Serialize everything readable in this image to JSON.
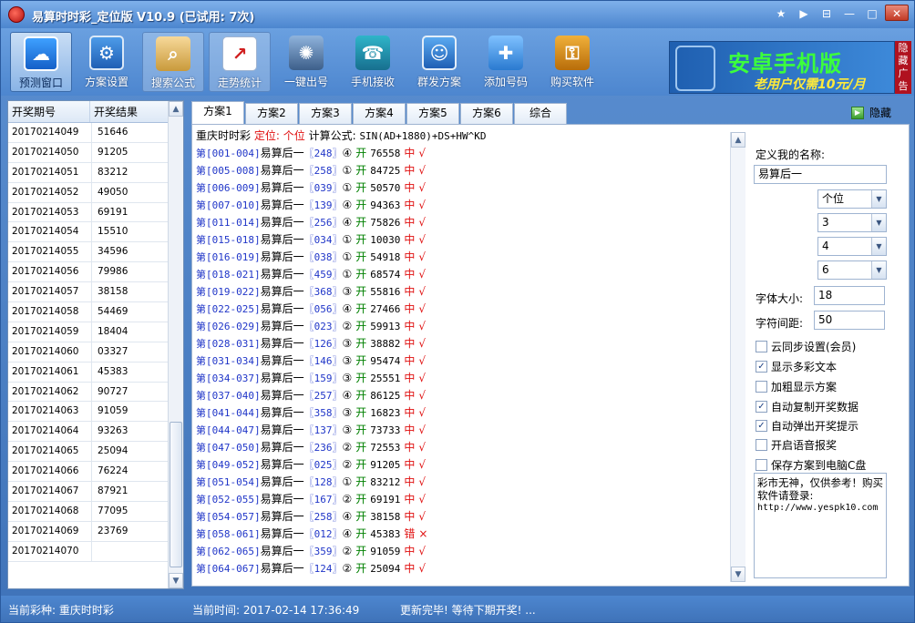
{
  "window": {
    "title": "易算时时彩_定位版 V10.9 (已试用: 7次)",
    "controls": [
      "★",
      "▶",
      "⊟",
      "—",
      "□",
      "✕"
    ]
  },
  "toolbar": {
    "items": [
      {
        "label": "预测窗口",
        "icon": "cloud-icon"
      },
      {
        "label": "方案设置",
        "icon": "settings-icon"
      },
      {
        "label": "搜索公式",
        "icon": "search-formula-icon"
      },
      {
        "label": "走势统计",
        "icon": "trend-chart-icon"
      },
      {
        "label": "一键出号",
        "icon": "gear-icon"
      },
      {
        "label": "手机接收",
        "icon": "phone-icon"
      },
      {
        "label": "群发方案",
        "icon": "group-icon"
      },
      {
        "label": "添加号码",
        "icon": "add-folder-icon"
      },
      {
        "label": "购买软件",
        "icon": "key-icon"
      }
    ]
  },
  "ad": {
    "title": "安卓手机版",
    "subtitle": "老用户仅需10元/月",
    "side_label": "隐藏广告"
  },
  "draw_list": {
    "headers": [
      "开奖期号",
      "开奖结果"
    ],
    "rows": [
      [
        "20170214049",
        "51646"
      ],
      [
        "20170214050",
        "91205"
      ],
      [
        "20170214051",
        "83212"
      ],
      [
        "20170214052",
        "49050"
      ],
      [
        "20170214053",
        "69191"
      ],
      [
        "20170214054",
        "15510"
      ],
      [
        "20170214055",
        "34596"
      ],
      [
        "20170214056",
        "79986"
      ],
      [
        "20170214057",
        "38158"
      ],
      [
        "20170214058",
        "54469"
      ],
      [
        "20170214059",
        "18404"
      ],
      [
        "20170214060",
        "03327"
      ],
      [
        "20170214061",
        "45383"
      ],
      [
        "20170214062",
        "90727"
      ],
      [
        "20170214063",
        "91059"
      ],
      [
        "20170214064",
        "93263"
      ],
      [
        "20170214065",
        "25094"
      ],
      [
        "20170214066",
        "76224"
      ],
      [
        "20170214067",
        "87921"
      ],
      [
        "20170214068",
        "77095"
      ],
      [
        "20170214069",
        "23769"
      ],
      [
        "20170214070",
        ""
      ]
    ]
  },
  "tabs": [
    "方案1",
    "方案2",
    "方案3",
    "方案4",
    "方案5",
    "方案6",
    "综合"
  ],
  "hide_label": "隐藏",
  "plan": {
    "header_game": "重庆时时彩",
    "header_pos_label": "定位:",
    "header_pos_value": "个位",
    "header_formula_label": "计算公式:",
    "header_formula": "SIN(AD+1880)+DS+HW^KD",
    "lines": [
      {
        "range": "第[001-004]",
        "name": "易算后一",
        "code": "〖248〗",
        "circle": "④",
        "open": "开",
        "result": "76558",
        "status": "中",
        "mark": "√"
      },
      {
        "range": "第[005-008]",
        "name": "易算后一",
        "code": "〖258〗",
        "circle": "①",
        "open": "开",
        "result": "84725",
        "status": "中",
        "mark": "√"
      },
      {
        "range": "第[006-009]",
        "name": "易算后一",
        "code": "〖039〗",
        "circle": "①",
        "open": "开",
        "result": "50570",
        "status": "中",
        "mark": "√"
      },
      {
        "range": "第[007-010]",
        "name": "易算后一",
        "code": "〖139〗",
        "circle": "④",
        "open": "开",
        "result": "94363",
        "status": "中",
        "mark": "√"
      },
      {
        "range": "第[011-014]",
        "name": "易算后一",
        "code": "〖256〗",
        "circle": "④",
        "open": "开",
        "result": "75826",
        "status": "中",
        "mark": "√"
      },
      {
        "range": "第[015-018]",
        "name": "易算后一",
        "code": "〖034〗",
        "circle": "①",
        "open": "开",
        "result": "10030",
        "status": "中",
        "mark": "√"
      },
      {
        "range": "第[016-019]",
        "name": "易算后一",
        "code": "〖038〗",
        "circle": "①",
        "open": "开",
        "result": "54918",
        "status": "中",
        "mark": "√"
      },
      {
        "range": "第[018-021]",
        "name": "易算后一",
        "code": "〖459〗",
        "circle": "①",
        "open": "开",
        "result": "68574",
        "status": "中",
        "mark": "√"
      },
      {
        "range": "第[019-022]",
        "name": "易算后一",
        "code": "〖368〗",
        "circle": "③",
        "open": "开",
        "result": "55816",
        "status": "中",
        "mark": "√"
      },
      {
        "range": "第[022-025]",
        "name": "易算后一",
        "code": "〖056〗",
        "circle": "④",
        "open": "开",
        "result": "27466",
        "status": "中",
        "mark": "√"
      },
      {
        "range": "第[026-029]",
        "name": "易算后一",
        "code": "〖023〗",
        "circle": "②",
        "open": "开",
        "result": "59913",
        "status": "中",
        "mark": "√"
      },
      {
        "range": "第[028-031]",
        "name": "易算后一",
        "code": "〖126〗",
        "circle": "③",
        "open": "开",
        "result": "38882",
        "status": "中",
        "mark": "√"
      },
      {
        "range": "第[031-034]",
        "name": "易算后一",
        "code": "〖146〗",
        "circle": "③",
        "open": "开",
        "result": "95474",
        "status": "中",
        "mark": "√"
      },
      {
        "range": "第[034-037]",
        "name": "易算后一",
        "code": "〖159〗",
        "circle": "③",
        "open": "开",
        "result": "25551",
        "status": "中",
        "mark": "√"
      },
      {
        "range": "第[037-040]",
        "name": "易算后一",
        "code": "〖257〗",
        "circle": "④",
        "open": "开",
        "result": "86125",
        "status": "中",
        "mark": "√"
      },
      {
        "range": "第[041-044]",
        "name": "易算后一",
        "code": "〖358〗",
        "circle": "③",
        "open": "开",
        "result": "16823",
        "status": "中",
        "mark": "√"
      },
      {
        "range": "第[044-047]",
        "name": "易算后一",
        "code": "〖137〗",
        "circle": "③",
        "open": "开",
        "result": "73733",
        "status": "中",
        "mark": "√"
      },
      {
        "range": "第[047-050]",
        "name": "易算后一",
        "code": "〖236〗",
        "circle": "②",
        "open": "开",
        "result": "72553",
        "status": "中",
        "mark": "√"
      },
      {
        "range": "第[049-052]",
        "name": "易算后一",
        "code": "〖025〗",
        "circle": "②",
        "open": "开",
        "result": "91205",
        "status": "中",
        "mark": "√"
      },
      {
        "range": "第[051-054]",
        "name": "易算后一",
        "code": "〖128〗",
        "circle": "①",
        "open": "开",
        "result": "83212",
        "status": "中",
        "mark": "√"
      },
      {
        "range": "第[052-055]",
        "name": "易算后一",
        "code": "〖167〗",
        "circle": "②",
        "open": "开",
        "result": "69191",
        "status": "中",
        "mark": "√"
      },
      {
        "range": "第[054-057]",
        "name": "易算后一",
        "code": "〖258〗",
        "circle": "④",
        "open": "开",
        "result": "38158",
        "status": "中",
        "mark": "√"
      },
      {
        "range": "第[058-061]",
        "name": "易算后一",
        "code": "〖012〗",
        "circle": "④",
        "open": "开",
        "result": "45383",
        "status": "错",
        "mark": "×"
      },
      {
        "range": "第[062-065]",
        "name": "易算后一",
        "code": "〖359〗",
        "circle": "②",
        "open": "开",
        "result": "91059",
        "status": "中",
        "mark": "√"
      },
      {
        "range": "第[064-067]",
        "name": "易算后一",
        "code": "〖124〗",
        "circle": "②",
        "open": "开",
        "result": "25094",
        "status": "中",
        "mark": "√"
      }
    ]
  },
  "settings": {
    "name_label": "定义我的名称:",
    "name_value": "易算后一",
    "selects": [
      "个位",
      "3",
      "4",
      "6"
    ],
    "font_size_label": "字体大小:",
    "font_size_value": "18",
    "spacing_label": "字符间距:",
    "spacing_value": "50",
    "checkboxes": [
      {
        "label": "云同步设置(会员)",
        "checked": false
      },
      {
        "label": "显示多彩文本",
        "checked": true
      },
      {
        "label": "加粗显示方案",
        "checked": false
      },
      {
        "label": "自动复制开奖数据",
        "checked": true
      },
      {
        "label": "自动弹出开奖提示",
        "checked": true
      },
      {
        "label": "开启语音报奖",
        "checked": false
      },
      {
        "label": "保存方案到电脑C盘",
        "checked": false
      }
    ],
    "note_text": "彩市无神，仅供参考！购买软件请登录:",
    "note_url": "http://www.yespk10.com"
  },
  "status": {
    "game_label": "当前彩种: 重庆时时彩",
    "time_label": "当前时间: 2017-02-14 17:36:49",
    "message": "更新完毕! 等待下期开奖! ..."
  },
  "colors": {
    "frame": "#4c86cf",
    "blue_text": "#2036c8",
    "red_text": "#e01010",
    "ad_green": "#3cff3c",
    "ad_yellow": "#ffea3a"
  }
}
